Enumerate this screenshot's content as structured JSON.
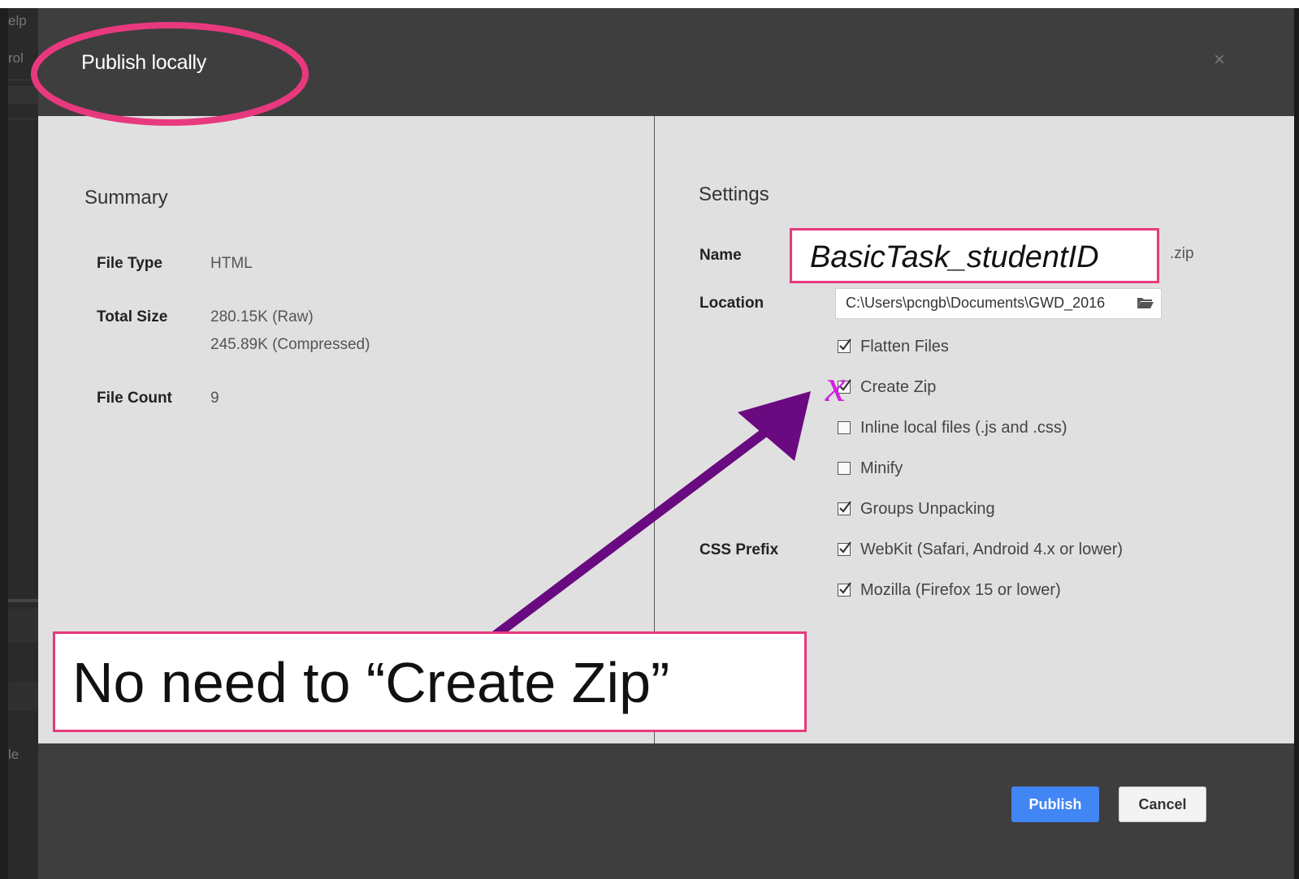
{
  "app": {
    "left_labels": [
      "elp",
      "rol",
      "le"
    ]
  },
  "dialog": {
    "title": "Publish locally",
    "close_glyph": "×"
  },
  "summary": {
    "title": "Summary",
    "file_type_label": "File Type",
    "file_type_value": "HTML",
    "total_size_label": "Total Size",
    "total_size_raw": "280.15K (Raw)",
    "total_size_compressed": "245.89K (Compressed)",
    "file_count_label": "File Count",
    "file_count_value": "9"
  },
  "settings": {
    "title": "Settings",
    "name_label": "Name",
    "name_value": "BasicTask_studentID",
    "name_suffix": ".zip",
    "location_label": "Location",
    "location_value": "C:\\Users\\pcngb\\Documents\\GWD_2016",
    "css_prefix_label": "CSS Prefix",
    "options": [
      {
        "label": "Flatten Files",
        "checked": true
      },
      {
        "label": "Create Zip",
        "checked": true
      },
      {
        "label": "Inline local files (.js and .css)",
        "checked": false
      },
      {
        "label": "Minify",
        "checked": false
      },
      {
        "label": "Groups Unpacking",
        "checked": true
      },
      {
        "label": "WebKit (Safari, Android 4.x or lower)",
        "checked": true
      },
      {
        "label": "Mozilla (Firefox 15 or lower)",
        "checked": true
      }
    ]
  },
  "buttons": {
    "publish": "Publish",
    "cancel": "Cancel"
  },
  "annotations": {
    "note": "No need to “Create Zip”",
    "highlight_color": "#e8397e",
    "arrow_color": "#6a0a80",
    "cross_color": "#d020e0",
    "cross_glyph": "x"
  },
  "icons": {
    "close": "close-icon",
    "folder": "folder-icon",
    "checkbox": "checkbox-icon"
  }
}
